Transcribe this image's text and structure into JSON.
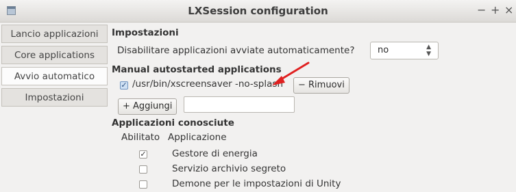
{
  "window": {
    "title": "LXSession configuration",
    "controls": [
      "−",
      "+",
      "×"
    ]
  },
  "sidebar": {
    "items": [
      {
        "label": "Lancio applicazioni",
        "active": false
      },
      {
        "label": "Core applications",
        "active": false
      },
      {
        "label": "Avvio automatico",
        "active": true
      },
      {
        "label": "Impostazioni",
        "active": false
      }
    ]
  },
  "settings": {
    "section_title": "Impostazioni",
    "disable_label": "Disabilitare applicazioni avviate automaticamente?",
    "disable_value": "no"
  },
  "manual": {
    "section_title": "Manual autostarted applications",
    "item_label": "/usr/bin/xscreensaver -no-splash",
    "item_checked": true,
    "remove_label": "− Rimuovi",
    "add_label": "+ Aggiungi",
    "add_input_value": ""
  },
  "known": {
    "section_title": "Applicazioni conosciute",
    "columns": [
      "Abilitato",
      "Applicazione"
    ],
    "rows": [
      {
        "enabled": true,
        "name": "Gestore di energia"
      },
      {
        "enabled": false,
        "name": "Servizio archivio segreto"
      },
      {
        "enabled": false,
        "name": "Demone per le impostazioni di Unity"
      }
    ]
  },
  "colors": {
    "arrow": "#e02020",
    "accent_check": "#cfe0f3"
  }
}
